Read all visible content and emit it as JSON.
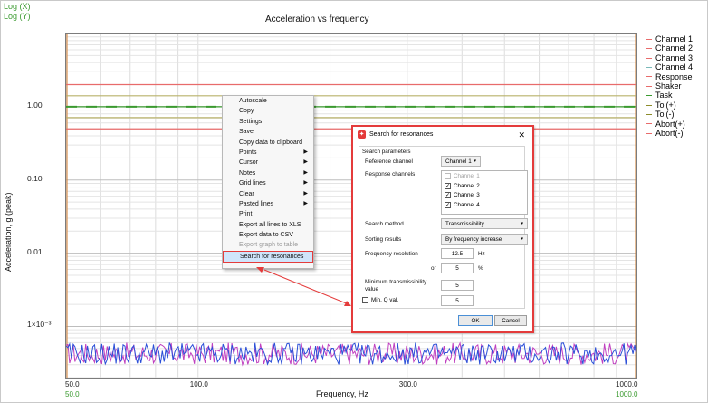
{
  "window": {
    "log_x_label": "Log (X)",
    "log_y_label": "Log (Y)"
  },
  "chart_data": {
    "type": "line",
    "title": "Acceleration vs frequency",
    "xlabel": "Frequency, Hz",
    "ylabel": "Acceleration, g (peak)",
    "x_scale": "log",
    "y_scale": "log",
    "xlim": [
      50,
      1000
    ],
    "ylim": [
      0.0002,
      10
    ],
    "x_ticks": [
      "50.0",
      "100.0",
      "300.0",
      "1000.0"
    ],
    "x_secondary_ticks": [
      "50.0",
      "1000.0"
    ],
    "y_ticks": [
      "1.00",
      "0.10",
      "0.01",
      "1×10⁻³"
    ],
    "legend_position": "right",
    "series": [
      {
        "name": "Channel 1",
        "color": "#e86b6b"
      },
      {
        "name": "Channel 2",
        "color": "#e86b6b"
      },
      {
        "name": "Channel 3",
        "color": "#e86b6b"
      },
      {
        "name": "Channel 4",
        "color": "#7ab9b9"
      },
      {
        "name": "Response",
        "color": "#e86b6b"
      },
      {
        "name": "Shaker",
        "color": "#e86b6b"
      },
      {
        "name": "Task",
        "color": "#3a9a2f"
      },
      {
        "name": "Tol(+)",
        "color": "#8c8c2a"
      },
      {
        "name": "Tol(-)",
        "color": "#8c8c2a"
      },
      {
        "name": "Abort(+)",
        "color": "#e86b6b"
      },
      {
        "name": "Abort(-)",
        "color": "#e86b6b"
      }
    ],
    "horizontal_levels": [
      {
        "name": "Abort(+)",
        "value": 2.0,
        "color": "#e86b6b"
      },
      {
        "name": "Tol(+)",
        "value": 1.41,
        "color": "#b9b26a"
      },
      {
        "name": "Task",
        "value": 1.0,
        "color": "#3a9a2f"
      },
      {
        "name": "Tol(-)",
        "value": 0.71,
        "color": "#b9b26a"
      },
      {
        "name": "Abort(-)",
        "value": 0.5,
        "color": "#e86b6b"
      }
    ],
    "noise_band": {
      "value_low": 0.0003,
      "value_high": 0.0006
    }
  },
  "context_menu": {
    "items": [
      {
        "label": "Autoscale",
        "submenu": false,
        "disabled": false
      },
      {
        "label": "Copy",
        "submenu": false,
        "disabled": false
      },
      {
        "label": "Settings",
        "submenu": false,
        "disabled": false
      },
      {
        "label": "Save",
        "submenu": false,
        "disabled": false
      },
      {
        "label": "Copy data to clipboard",
        "submenu": false,
        "disabled": false
      },
      {
        "label": "Points",
        "submenu": true,
        "disabled": false
      },
      {
        "label": "Cursor",
        "submenu": true,
        "disabled": false
      },
      {
        "label": "Notes",
        "submenu": true,
        "disabled": false
      },
      {
        "label": "Grid lines",
        "submenu": true,
        "disabled": false
      },
      {
        "label": "Clear",
        "submenu": true,
        "disabled": false
      },
      {
        "label": "Pasted lines",
        "submenu": true,
        "disabled": false
      },
      {
        "label": "Print",
        "submenu": false,
        "disabled": false
      },
      {
        "label": "Export all lines to XLS",
        "submenu": false,
        "disabled": false
      },
      {
        "label": "Export data to CSV",
        "submenu": false,
        "disabled": false
      },
      {
        "label": "Export graph to table",
        "submenu": false,
        "disabled": true
      },
      {
        "label": "Search for resonances",
        "submenu": false,
        "disabled": false,
        "highlight": true
      }
    ]
  },
  "dialog": {
    "title": "Search for resonances",
    "close_glyph": "✕",
    "group_label": "Search parameters",
    "reference_channel_label": "Reference channel",
    "reference_channel_value": "Channel 1",
    "response_channels_label": "Response channels",
    "response_channels": [
      {
        "label": "Channel 1",
        "checked": false,
        "disabled": true
      },
      {
        "label": "Channel 2",
        "checked": true,
        "disabled": false
      },
      {
        "label": "Channel 3",
        "checked": true,
        "disabled": false
      },
      {
        "label": "Channel 4",
        "checked": true,
        "disabled": false
      }
    ],
    "search_method_label": "Search method",
    "search_method_value": "Transmissibility",
    "sorting_results_label": "Sorting results",
    "sorting_results_value": "By frequency increase",
    "frequency_resolution_label": "Frequency resolution",
    "frequency_resolution_value": "12.5",
    "frequency_resolution_unit": "Hz",
    "or_label": "or",
    "percent_value": "5",
    "percent_unit": "%",
    "min_transmissibility_label": "Minimum transmissibility value",
    "min_transmissibility_value": "5",
    "min_q_label": "Min. Q val.",
    "min_q_checked": false,
    "min_q_value": "5",
    "ok_label": "OK",
    "cancel_label": "Cancel"
  },
  "annotation_color": "#e43b3b"
}
